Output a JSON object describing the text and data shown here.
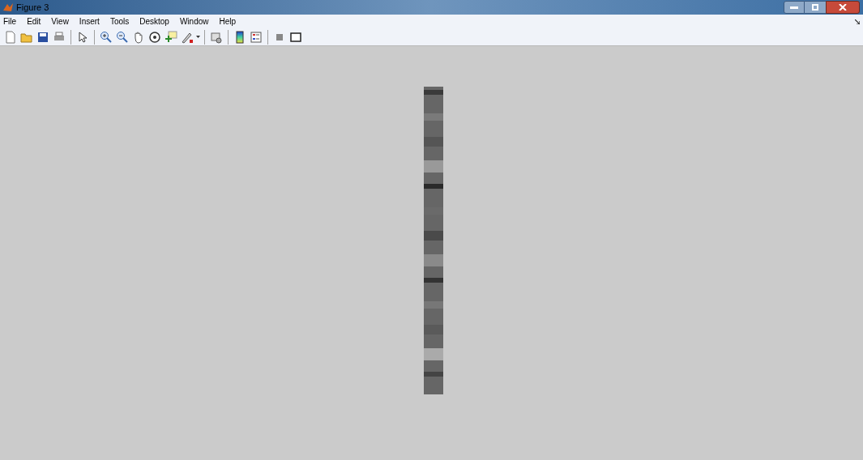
{
  "window": {
    "title": "Figure 3"
  },
  "menu": [
    "File",
    "Edit",
    "View",
    "Insert",
    "Tools",
    "Desktop",
    "Window",
    "Help"
  ]
}
